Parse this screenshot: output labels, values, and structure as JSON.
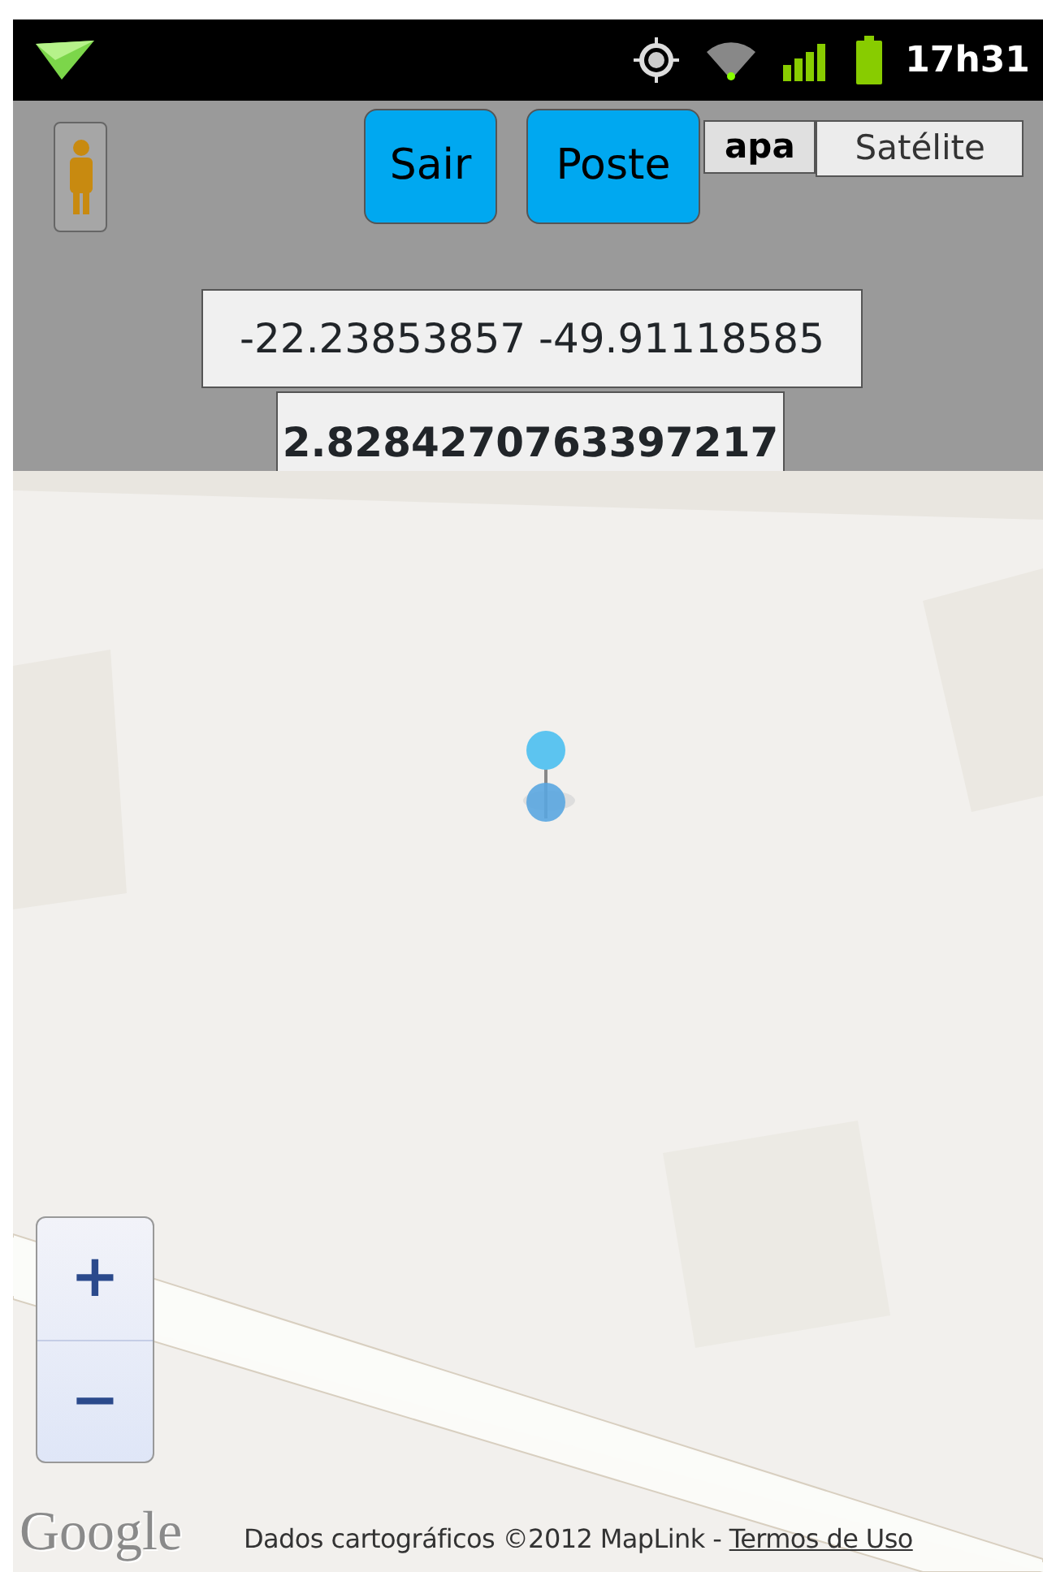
{
  "status_bar": {
    "time": "17h31"
  },
  "buttons": [
    {
      "label": "Sair"
    },
    {
      "label": "Poste"
    }
  ],
  "map_type_tabs": [
    {
      "label": "apa",
      "selected": true
    },
    {
      "label": "Satélite",
      "selected": false
    }
  ],
  "coordinates": "-22.23853857 -49.91118585",
  "distance": "2.8284270763397217",
  "map": {
    "zoom_controls": [
      "+",
      "−"
    ],
    "logo": "Google",
    "attribution": {
      "text": "Dados cartográficos ©2012 MapLink - ",
      "link": "Termos de Uso"
    }
  }
}
